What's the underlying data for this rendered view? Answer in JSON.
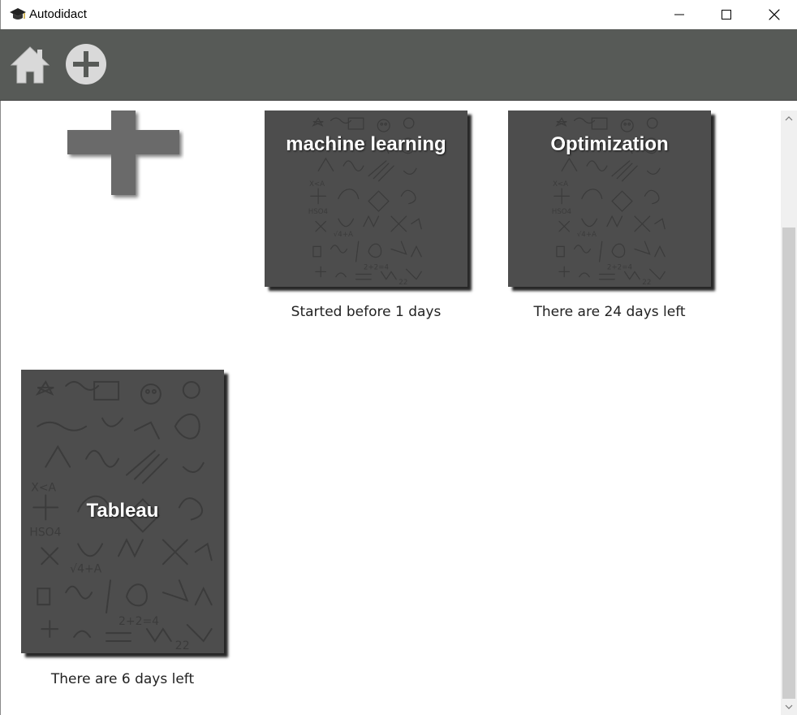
{
  "window": {
    "title": "Autodidact",
    "app_icon": "graduation-cap-icon",
    "controls": [
      "minimize-icon",
      "maximize-icon",
      "close-icon"
    ]
  },
  "toolbar": {
    "buttons": [
      "home-icon",
      "add-circle-icon"
    ]
  },
  "content": {
    "add_tile_icon": "plus-icon",
    "cards": [
      {
        "title": "machine learning",
        "status": "Started before 1 days"
      },
      {
        "title": "Optimization",
        "status": "There are 24 days left"
      },
      {
        "title": "Tableau",
        "status": "There are 6 days left"
      }
    ]
  },
  "colors": {
    "toolbar": "#575a57",
    "card_background": "#4d4d4d",
    "card_text": "#ffffff",
    "scroll_thumb": "#cdcdcd"
  }
}
